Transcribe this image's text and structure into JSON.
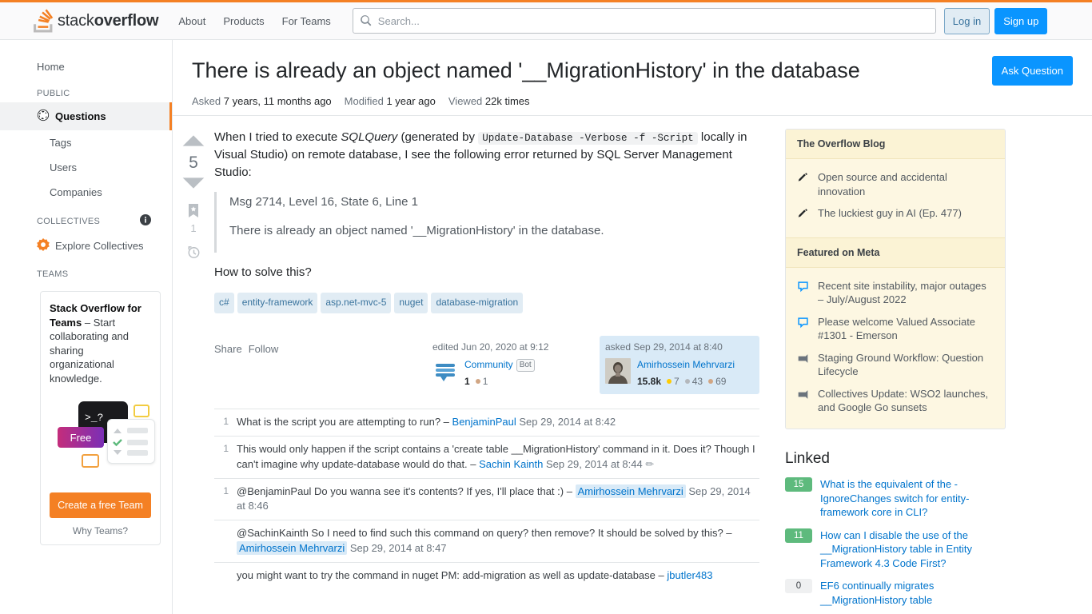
{
  "header": {
    "logo_light": "stack",
    "logo_bold": "overflow",
    "nav": [
      {
        "label": "About"
      },
      {
        "label": "Products"
      },
      {
        "label": "For Teams"
      }
    ],
    "search": {
      "placeholder": "Search...",
      "value": "",
      "icon": "search-icon"
    },
    "login_label": "Log in",
    "signup_label": "Sign up"
  },
  "sidebar": {
    "home_label": "Home",
    "public_heading": "PUBLIC",
    "public_items": [
      {
        "label": "Questions",
        "icon": "globe-icon",
        "selected": true
      },
      {
        "label": "Tags",
        "selected": false
      },
      {
        "label": "Users",
        "selected": false
      },
      {
        "label": "Companies",
        "selected": false
      }
    ],
    "collectives_heading": "COLLECTIVES",
    "collectives_info_icon": "info-icon",
    "explore_collectives_label": "Explore Collectives",
    "teams_heading": "TEAMS",
    "teams_promo": {
      "title": "Stack Overflow for Teams",
      "body": " – Start collaborating and sharing organizational knowledge.",
      "free_badge": "Free",
      "terminal_glyph": ">_?",
      "cta_label": "Create a free Team",
      "why_label": "Why Teams?"
    }
  },
  "question": {
    "title": "There is already an object named '__MigrationHistory' in the database",
    "ask_button": "Ask Question",
    "meta": {
      "asked_label": "Asked",
      "asked_value": "7 years, 11 months ago",
      "modified_label": "Modified",
      "modified_value": "1 year ago",
      "viewed_label": "Viewed",
      "viewed_value": "22k times"
    },
    "votes": "5",
    "bookmark_count": "1",
    "body": {
      "p1_a": "When I tried to execute ",
      "p1_em": "SQLQuery",
      "p1_b": " (generated by ",
      "p1_code": "Update-Database -Verbose -f -Script",
      "p1_c": " locally in Visual Studio) on remote database, I see the following error returned by SQL Server Management Studio:",
      "quote_line1": "Msg 2714, Level 16, State 6, Line 1",
      "quote_line2": "There is already an object named '__MigrationHistory' in the database.",
      "p2": "How to solve this?"
    },
    "tags": [
      "c#",
      "entity-framework",
      "asp.net-mvc-5",
      "nuget",
      "database-migration"
    ],
    "share_label": "Share",
    "follow_label": "Follow",
    "editor_card": {
      "action": "edited Jun 20, 2020 at 9:12",
      "name": "Community",
      "bot_label": "Bot",
      "rep": "1",
      "bronze": "1"
    },
    "owner_card": {
      "action": "asked Sep 29, 2014 at 8:40",
      "name": "Amirhossein Mehrvarzi",
      "rep": "15.8k",
      "gold": "7",
      "silver": "43",
      "bronze": "69"
    }
  },
  "comments": [
    {
      "score": "1",
      "text": "What is the script you are attempting to run? – ",
      "user": "BenjaminPaul",
      "owner": false,
      "date": "Sep 29, 2014 at 8:42",
      "edit": ""
    },
    {
      "score": "1",
      "text": "This would only happen if the script contains a 'create table __MigrationHistory' command in it. Does it? Though I can't imagine why update-database would do that. – ",
      "user": "Sachin Kainth",
      "owner": false,
      "date": "Sep 29, 2014 at 8:44",
      "edit": "✏"
    },
    {
      "score": "1",
      "text": "@BenjaminPaul Do you wanna see it's contents? If yes, I'll place that :) – ",
      "user": "Amirhossein Mehrvarzi",
      "owner": true,
      "date": "Sep 29, 2014 at 8:46",
      "edit": ""
    },
    {
      "score": "",
      "text": "@SachinKainth So I need to find such this command on query? then remove? It should be solved by this? – ",
      "user": "Amirhossein Mehrvarzi",
      "owner": true,
      "date": "Sep 29, 2014 at 8:47",
      "edit": ""
    },
    {
      "score": "",
      "text": "you might want to try the command in nuget PM: add-migration as well as update-database – ",
      "user": "jbutler483",
      "owner": false,
      "date": "",
      "edit": ""
    }
  ],
  "rightbar": {
    "blog_heading": "The Overflow Blog",
    "blog_items": [
      {
        "label": "Open source and accidental innovation",
        "icon": "pencil-icon"
      },
      {
        "label": "The luckiest guy in AI (Ep. 477)",
        "icon": "pencil-icon"
      }
    ],
    "meta_heading": "Featured on Meta",
    "meta_items": [
      {
        "label": "Recent site instability, major outages – July/August 2022",
        "icon": "speech-bubble-icon"
      },
      {
        "label": "Please welcome Valued Associate #1301 - Emerson",
        "icon": "speech-bubble-icon"
      },
      {
        "label": "Staging Ground Workflow: Question Lifecycle",
        "icon": "announcement-icon"
      },
      {
        "label": "Collectives Update: WSO2 launches, and Google Go sunsets",
        "icon": "announcement-icon"
      }
    ],
    "linked_heading": "Linked",
    "linked_items": [
      {
        "score": "15",
        "label": "What is the equivalent of the -IgnoreChanges switch for entity-framework core in CLI?",
        "zero": false
      },
      {
        "score": "11",
        "label": "How can I disable the use of the __MigrationHistory table in Entity Framework 4.3 Code First?",
        "zero": false
      },
      {
        "score": "0",
        "label": "EF6 continually migrates __MigrationHistory table",
        "zero": true
      }
    ]
  },
  "colors": {
    "orange": "#F48024",
    "blue": "#0A95FF",
    "link": "#0074CC",
    "tag_bg": "#E1ECF4",
    "tag_fg": "#39739D",
    "blog_bg": "#FDF7E2",
    "green": "#5EBA7D"
  }
}
